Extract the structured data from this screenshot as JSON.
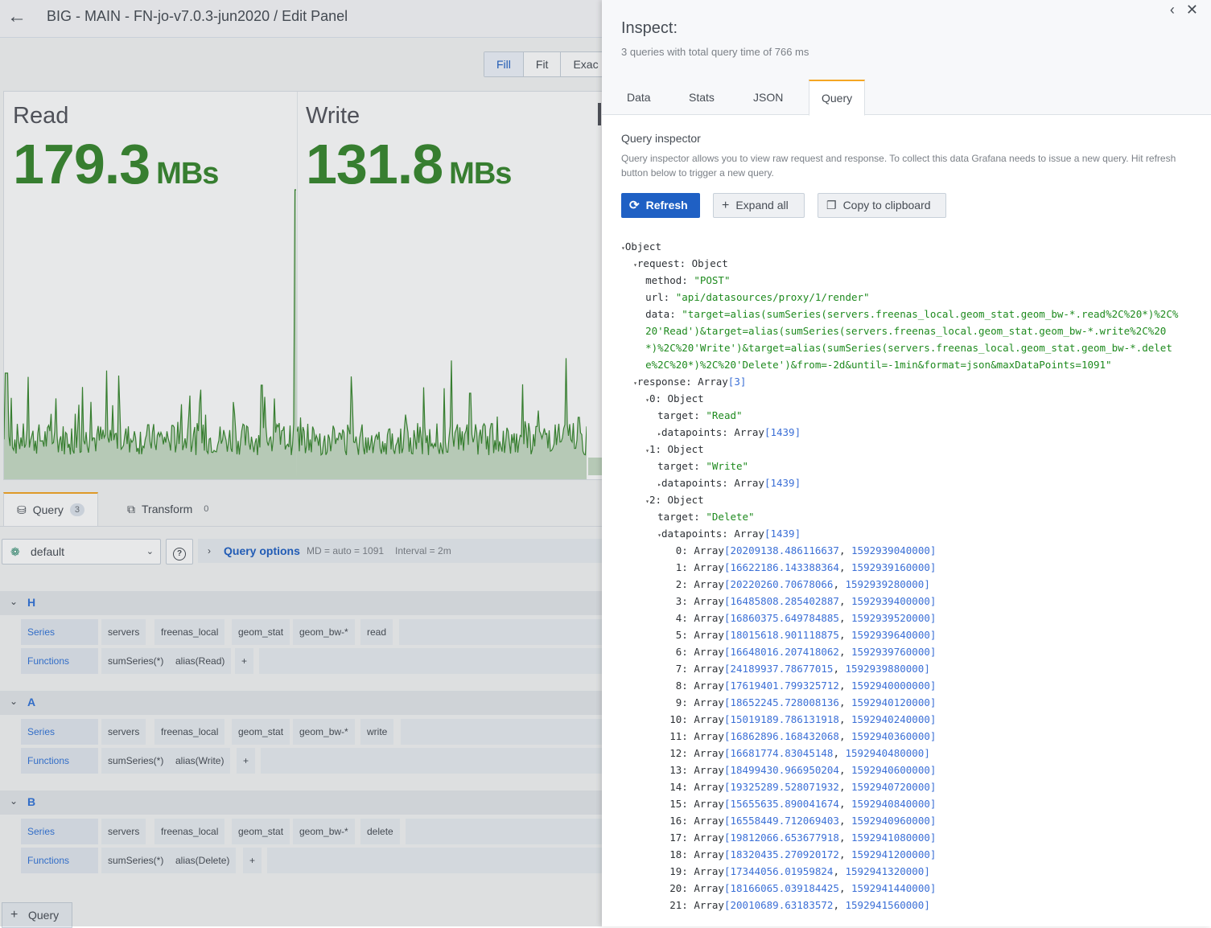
{
  "topbar": {
    "back_icon": "arrow-left-icon",
    "breadcrumb": "BIG - MAIN - FN-jo-v7.0.3-jun2020 / Edit Panel"
  },
  "view_modes": [
    "Fill",
    "Fit",
    "Exac"
  ],
  "stats": [
    {
      "title": "Read",
      "value": "179.3",
      "unit": "MBs"
    },
    {
      "title": "Write",
      "value": "131.8",
      "unit": "MBs"
    }
  ],
  "editor_tabs": {
    "query_label": "Query",
    "query_count": "3",
    "transform_label": "Transform",
    "transform_count": "0"
  },
  "datasource": {
    "selected": "default",
    "help": "?",
    "query_options": "Query options",
    "md": "MD = auto = 1091",
    "interval": "Interval = 2m"
  },
  "queries": [
    {
      "ref": "H",
      "series_label": "Series",
      "series": [
        "servers",
        "freenas_local",
        "geom_stat",
        "geom_bw-*",
        "read"
      ],
      "functions_label": "Functions",
      "functions": [
        "sumSeries(*)",
        "alias(Read)",
        "+"
      ]
    },
    {
      "ref": "A",
      "series_label": "Series",
      "series": [
        "servers",
        "freenas_local",
        "geom_stat",
        "geom_bw-*",
        "write"
      ],
      "functions_label": "Functions",
      "functions": [
        "sumSeries(*)",
        "alias(Write)",
        "+"
      ]
    },
    {
      "ref": "B",
      "series_label": "Series",
      "series": [
        "servers",
        "freenas_local",
        "geom_stat",
        "geom_bw-*",
        "delete"
      ],
      "functions_label": "Functions",
      "functions": [
        "sumSeries(*)",
        "alias(Delete)",
        "+"
      ]
    }
  ],
  "add_query": "Query",
  "inspector": {
    "title": "Inspect:",
    "subtitle": "3 queries with total query time of 766 ms",
    "tabs": [
      "Data",
      "Stats",
      "JSON",
      "Query"
    ],
    "active_tab": "Query",
    "section_title": "Query inspector",
    "description": "Query inspector allows you to view raw request and response. To collect this data Grafana needs to issue a new query. Hit refresh button below to trigger a new query.",
    "buttons": {
      "refresh": "Refresh",
      "expand": "Expand all",
      "copy": "Copy to clipboard"
    },
    "json_tree": {
      "root": "Object",
      "request_key": "request:",
      "request_type": "Object",
      "method_key": "method:",
      "method": "\"POST\"",
      "url_key": "url:",
      "url": "\"api/datasources/proxy/1/render\"",
      "data_key": "data:",
      "data_lines": [
        "\"target=alias(sumSeries(servers.freenas_local.geom_stat.geom_bw-*.read%2C%20*)%2C%",
        "20'Read')&target=alias(sumSeries(servers.freenas_local.geom_stat.geom_bw-*.write%2C%20",
        "*)%2C%20'Write')&target=alias(sumSeries(servers.freenas_local.geom_stat.geom_bw-*.delet",
        "e%2C%20*)%2C%20'Delete')&from=-2d&until=-1min&format=json&maxDataPoints=1091\""
      ],
      "response_key": "response:",
      "response_type": "Array",
      "response_len": "[3]",
      "items": [
        {
          "idx": "0:",
          "type": "Object",
          "target_key": "target:",
          "target": "\"Read\"",
          "dp_key": "datapoints:",
          "dp_type": "Array",
          "dp_len": "[1439]"
        },
        {
          "idx": "1:",
          "type": "Object",
          "target_key": "target:",
          "target": "\"Write\"",
          "dp_key": "datapoints:",
          "dp_type": "Array",
          "dp_len": "[1439]"
        },
        {
          "idx": "2:",
          "type": "Object",
          "target_key": "target:",
          "target": "\"Delete\"",
          "dp_key": "datapoints:",
          "dp_type": "Array",
          "dp_len": "[1439]"
        }
      ],
      "datapoints": [
        [
          "0:",
          "20209138.486116637",
          "1592939040000"
        ],
        [
          "1:",
          "16622186.143388364",
          "1592939160000"
        ],
        [
          "2:",
          "20220260.70678066",
          "1592939280000"
        ],
        [
          "3:",
          "16485808.285402887",
          "1592939400000"
        ],
        [
          "4:",
          "16860375.649784885",
          "1592939520000"
        ],
        [
          "5:",
          "18015618.901118875",
          "1592939640000"
        ],
        [
          "6:",
          "16648016.207418062",
          "1592939760000"
        ],
        [
          "7:",
          "24189937.78677015",
          "1592939880000"
        ],
        [
          "8:",
          "17619401.799325712",
          "1592940000000"
        ],
        [
          "9:",
          "18652245.728008136",
          "1592940120000"
        ],
        [
          "10:",
          "15019189.786131918",
          "1592940240000"
        ],
        [
          "11:",
          "16862896.168432068",
          "1592940360000"
        ],
        [
          "12:",
          "16681774.83045148",
          "1592940480000"
        ],
        [
          "13:",
          "18499430.966950204",
          "1592940600000"
        ],
        [
          "14:",
          "19325289.528071932",
          "1592940720000"
        ],
        [
          "15:",
          "15655635.890041674",
          "1592940840000"
        ],
        [
          "16:",
          "16558449.712069403",
          "1592940960000"
        ],
        [
          "17:",
          "19812066.653677918",
          "1592941080000"
        ],
        [
          "18:",
          "18320435.270920172",
          "1592941200000"
        ],
        [
          "19:",
          "17344056.01959824",
          "1592941320000"
        ],
        [
          "20:",
          "18166065.039184425",
          "1592941440000"
        ],
        [
          "21:",
          "20010689.63183572",
          "1592941560000"
        ]
      ],
      "array_word": "Array"
    }
  },
  "colors": {
    "stat_green": "#37872d",
    "primary_blue": "#1f60c4",
    "tab_accent": "#f5a623",
    "json_string": "#1e8a1e",
    "json_number": "#3b6fd6"
  }
}
